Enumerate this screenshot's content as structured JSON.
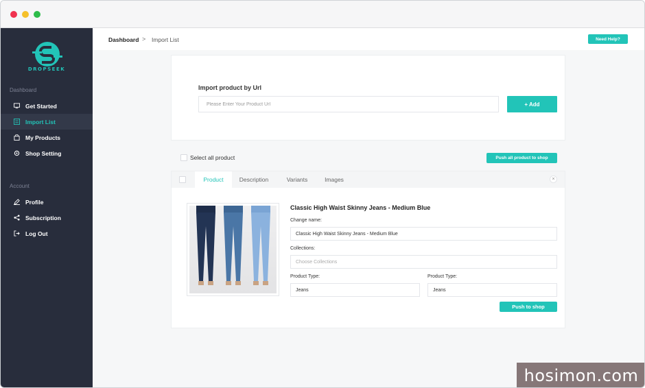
{
  "window": {
    "controls": [
      "close",
      "minimize",
      "maximize"
    ]
  },
  "brand": {
    "name": "DROPSEEK",
    "accent": "#22c4b8",
    "sidebar_bg": "#282d3c"
  },
  "sidebar": {
    "section_dashboard": "Dashboard",
    "section_account": "Account",
    "items": [
      {
        "label": "Get Started",
        "icon": "monitor-icon"
      },
      {
        "label": "Import List",
        "icon": "list-icon",
        "active": true
      },
      {
        "label": "My Products",
        "icon": "bag-icon"
      },
      {
        "label": "Shop Setting",
        "icon": "gear-icon"
      }
    ],
    "account_items": [
      {
        "label": "Profile",
        "icon": "pen-icon"
      },
      {
        "label": "Subscription",
        "icon": "share-icon"
      },
      {
        "label": "Log Out",
        "icon": "logout-icon"
      }
    ]
  },
  "header": {
    "breadcrumb": [
      "Dashboard",
      "Import List"
    ],
    "breadcrumb_sep": ">",
    "help_label": "Need Help?"
  },
  "import": {
    "title": "Import product by Url",
    "placeholder": "Please Enter Your Product Url",
    "add_label": "+ Add"
  },
  "bulk": {
    "select_all_label": "Select all product",
    "push_all_label": "Push all product to shop"
  },
  "product": {
    "tabs": [
      "Product",
      "Description",
      "Variants",
      "Images"
    ],
    "active_tab": "Product",
    "close_label": "×",
    "image_alt": "Jeans product photo",
    "title": "Classic High Waist Skinny Jeans - Medium Blue",
    "change_name_label": "Change name:",
    "change_name_value": "Classic High Waist Skinny Jeans - Medium Blue",
    "collections_label": "Collections:",
    "collections_placeholder": "Choose Collections",
    "product_type_label_1": "Product Type:",
    "product_type_value_1": "Jeans",
    "product_type_label_2": "Product Type:",
    "product_type_value_2": "Jeans",
    "push_label": "Push to shop"
  },
  "watermark": "hosimon.com"
}
